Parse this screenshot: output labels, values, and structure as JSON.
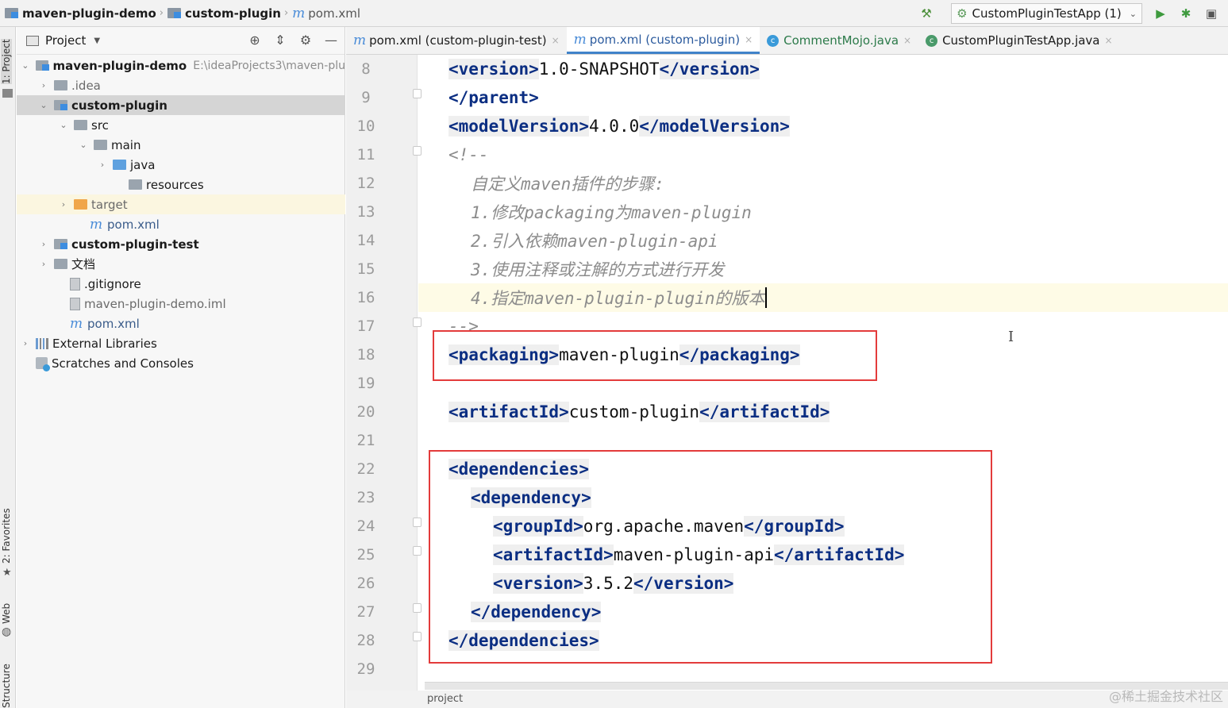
{
  "navbar": {
    "crumbs": [
      {
        "label": "maven-plugin-demo"
      },
      {
        "label": "custom-plugin"
      },
      {
        "label": "pom.xml"
      }
    ],
    "run_config": "CustomPluginTestApp (1)",
    "icons": [
      "hammer-icon",
      "run-icon",
      "debug-icon",
      "coverage-icon"
    ]
  },
  "left_strip": {
    "project": "1: Project",
    "favorites": "2: Favorites",
    "web": "Web",
    "structure": "Structure"
  },
  "project_panel": {
    "title": "Project",
    "tree": [
      {
        "label": "maven-plugin-demo",
        "path": "E:\\ideaProjects3\\maven-plu",
        "arrow": "⌄"
      },
      {
        "label": ".idea",
        "arrow": "›"
      },
      {
        "label": "custom-plugin",
        "arrow": "⌄"
      },
      {
        "label": "src",
        "arrow": "⌄"
      },
      {
        "label": "main",
        "arrow": "⌄"
      },
      {
        "label": "java",
        "arrow": "›"
      },
      {
        "label": "resources",
        "arrow": ""
      },
      {
        "label": "target",
        "arrow": "›"
      },
      {
        "label": "pom.xml",
        "arrow": ""
      },
      {
        "label": "custom-plugin-test",
        "arrow": "›"
      },
      {
        "label": "文档",
        "arrow": "›"
      },
      {
        "label": ".gitignore",
        "arrow": ""
      },
      {
        "label": "maven-plugin-demo.iml",
        "arrow": ""
      },
      {
        "label": "pom.xml",
        "arrow": ""
      },
      {
        "label": "External Libraries",
        "arrow": "›"
      },
      {
        "label": "Scratches and Consoles",
        "arrow": ""
      }
    ]
  },
  "editor": {
    "tabs": [
      {
        "label": "pom.xml (custom-plugin-test)"
      },
      {
        "label": "pom.xml (custom-plugin)"
      },
      {
        "label": "CommentMojo.java"
      },
      {
        "label": "CustomPluginTestApp.java"
      }
    ],
    "line_numbers": [
      "8",
      "9",
      "10",
      "11",
      "12",
      "13",
      "14",
      "15",
      "16",
      "17",
      "18",
      "19",
      "20",
      "21",
      "22",
      "23",
      "24",
      "25",
      "26",
      "27",
      "28",
      "29"
    ],
    "lines": {
      "l8": {
        "open": "<version>",
        "text": "1.0-SNAPSHOT",
        "close": "</version>"
      },
      "l9": {
        "close": "</parent>"
      },
      "l10": {
        "open": "<modelVersion>",
        "text": "4.0.0",
        "close": "</modelVersion>"
      },
      "l11": {
        "comment": "<!--"
      },
      "l12": {
        "comment": "自定义maven插件的步骤:"
      },
      "l13": {
        "comment": "1.修改packaging为maven-plugin"
      },
      "l14": {
        "comment": "2.引入依赖maven-plugin-api"
      },
      "l15": {
        "comment": "3.使用注释或注解的方式进行开发"
      },
      "l16": {
        "comment": "4.指定maven-plugin-plugin的版本"
      },
      "l17": {
        "comment": "-->"
      },
      "l18": {
        "open": "<packaging>",
        "text": "maven-plugin",
        "close": "</packaging>"
      },
      "l20": {
        "open": "<artifactId>",
        "text": "custom-plugin",
        "close": "</artifactId>"
      },
      "l22": {
        "open": "<dependencies>"
      },
      "l23": {
        "open": "<dependency>"
      },
      "l24": {
        "open": "<groupId>",
        "text": "org.apache.maven",
        "close": "</groupId>"
      },
      "l25": {
        "open": "<artifactId>",
        "text": "maven-plugin-api",
        "close": "</artifactId>"
      },
      "l26": {
        "open": "<version>",
        "text": "3.5.2",
        "close": "</version>"
      },
      "l27": {
        "close": "</dependency>"
      },
      "l28": {
        "close": "</dependencies>"
      }
    }
  },
  "status": {
    "text": "project"
  },
  "watermark": "@稀土掘金技术社区",
  "colors": {
    "tag": "#0b2e82",
    "comment": "#8c8c8c",
    "highlight_box": "#e33b3b",
    "current_line": "#fefbe6"
  }
}
